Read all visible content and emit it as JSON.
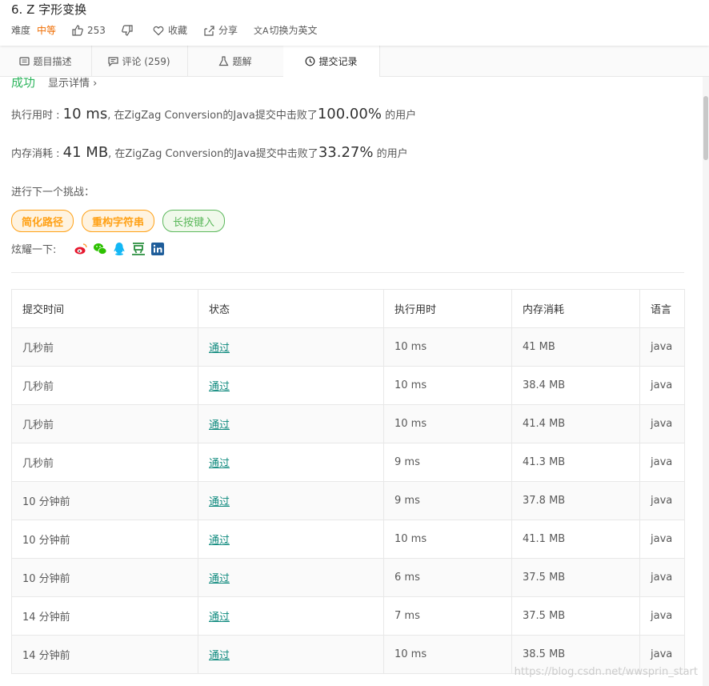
{
  "problem": {
    "title": "6. Z 字形变换",
    "difficulty_label": "难度",
    "difficulty": "中等",
    "likes": "253",
    "favorite": "收藏",
    "share": "分享",
    "switch_lang": "切换为英文"
  },
  "tabs": [
    {
      "label": "题目描述",
      "icon": "document-icon"
    },
    {
      "label": "评论 (259)",
      "icon": "comment-icon"
    },
    {
      "label": "题解",
      "icon": "flask-icon"
    },
    {
      "label": "提交记录",
      "icon": "clock-icon"
    }
  ],
  "result": {
    "status": "成功",
    "detail_link": "显示详情",
    "runtime": {
      "label": "执行用时 : ",
      "value": "10 ms",
      "middle": ", 在ZigZag Conversion的Java提交中击败了",
      "percent": "100.00%",
      "suffix": " 的用户"
    },
    "memory": {
      "label": "内存消耗 : ",
      "value": "41 MB",
      "middle": ", 在ZigZag Conversion的Java提交中击败了",
      "percent": "33.27%",
      "suffix": " 的用户"
    },
    "next_challenge_label": "进行下一个挑战：",
    "challenges": [
      "简化路径",
      "重构字符串",
      "长按键入"
    ],
    "share_label": "炫耀一下:",
    "share_icons": [
      "weibo-icon",
      "wechat-icon",
      "qq-icon",
      "douban-icon",
      "linkedin-icon"
    ]
  },
  "submissions": {
    "headers": [
      "提交时间",
      "状态",
      "执行用时",
      "内存消耗",
      "语言"
    ],
    "rows": [
      [
        "几秒前",
        "通过",
        "10 ms",
        "41 MB",
        "java"
      ],
      [
        "几秒前",
        "通过",
        "10 ms",
        "38.4 MB",
        "java"
      ],
      [
        "几秒前",
        "通过",
        "10 ms",
        "41.4 MB",
        "java"
      ],
      [
        "几秒前",
        "通过",
        "9 ms",
        "41.3 MB",
        "java"
      ],
      [
        "10 分钟前",
        "通过",
        "9 ms",
        "37.8 MB",
        "java"
      ],
      [
        "10 分钟前",
        "通过",
        "10 ms",
        "41.1 MB",
        "java"
      ],
      [
        "10 分钟前",
        "通过",
        "6 ms",
        "37.5 MB",
        "java"
      ],
      [
        "14 分钟前",
        "通过",
        "7 ms",
        "37.5 MB",
        "java"
      ],
      [
        "14 分钟前",
        "通过",
        "10 ms",
        "38.5 MB",
        "java"
      ]
    ]
  },
  "watermark": "https://blog.csdn.net/wwsprin_start",
  "colors": {
    "success": "#2db55d",
    "medium": "#ef6c00",
    "accent": "#ffa116",
    "link": "#0f8a7e"
  }
}
